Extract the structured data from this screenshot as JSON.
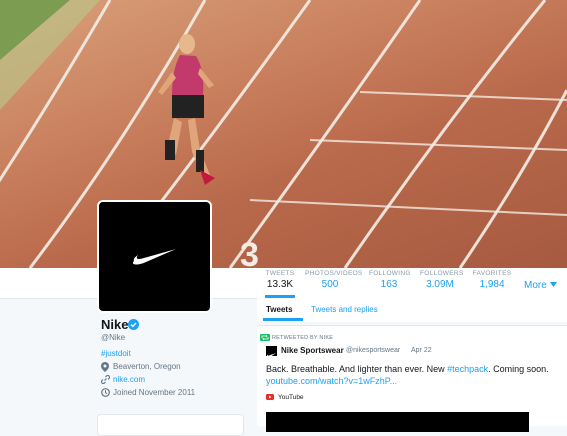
{
  "profile": {
    "name": "Nike",
    "handle": "@Nike",
    "hashtag": "#justdoit",
    "location": "Beaverton, Oregon",
    "website": "nike.com",
    "joined": "Joined November 2011"
  },
  "stats": [
    {
      "label": "TWEETS",
      "value": "13.3K"
    },
    {
      "label": "PHOTOS/VIDEOS",
      "value": "500"
    },
    {
      "label": "FOLLOWING",
      "value": "163"
    },
    {
      "label": "FOLLOWERS",
      "value": "3.09M"
    },
    {
      "label": "FAVORITES",
      "value": "1,984"
    }
  ],
  "more_label": "More",
  "tabs": {
    "tweets": "Tweets",
    "replies": "Tweets and replies"
  },
  "tweet": {
    "retweeted_by": "RETWEETED BY NIKE",
    "author": "Nike Sportswear",
    "author_handle": "@nikesportswear",
    "date": "Apr 22",
    "text_plain": "Back. Breathable. And lighter than ever. New ",
    "text_tag": "#techpack",
    "text_end": ". Coming soon.",
    "link": "youtube.com/watch?v=1wFzhP...",
    "source": "YouTube"
  },
  "banner": {
    "track_number": "3"
  },
  "colors": {
    "accent": "#1da1f2",
    "verified": "#1da1f2",
    "youtube": "#e52d27"
  }
}
